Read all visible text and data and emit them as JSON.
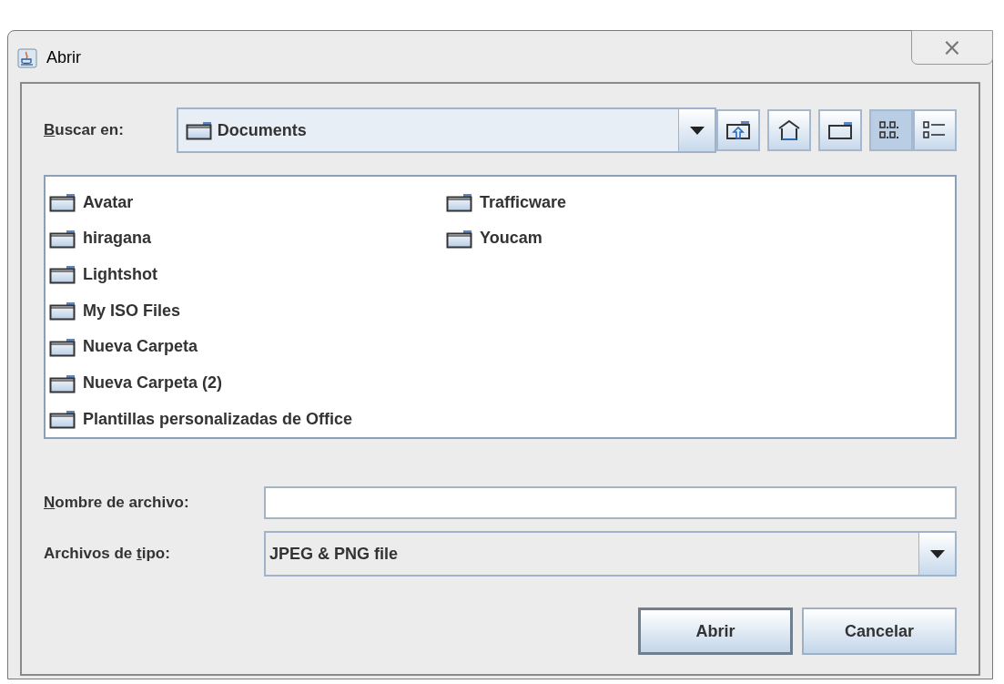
{
  "window": {
    "title": "Abrir",
    "close": "⨯"
  },
  "look_in": {
    "label": [
      {
        "text": "B",
        "mnemonic": true
      },
      {
        "text": "uscar en:",
        "mnemonic": false
      }
    ],
    "value": "Documents"
  },
  "toolbar": [
    {
      "kind": "up",
      "selected": false
    },
    {
      "kind": "home",
      "selected": false
    },
    {
      "kind": "new-folder",
      "selected": false
    },
    {
      "kind": "list",
      "selected": true
    },
    {
      "kind": "details",
      "selected": false
    }
  ],
  "files": [
    {
      "name": "Avatar"
    },
    {
      "name": "hiragana"
    },
    {
      "name": "Lightshot"
    },
    {
      "name": "My ISO Files"
    },
    {
      "name": "Nueva Carpeta"
    },
    {
      "name": "Nueva Carpeta (2)"
    },
    {
      "name": "Plantillas personalizadas de Office"
    },
    {
      "name": "Trafficware"
    },
    {
      "name": "Youcam"
    }
  ],
  "file_name": {
    "label": [
      {
        "text": "N",
        "mnemonic": true
      },
      {
        "text": "ombre de archivo:",
        "mnemonic": false
      }
    ]
  },
  "file_type": {
    "label": [
      {
        "text": "Archivos de ",
        "mnemonic": false
      },
      {
        "text": "t",
        "mnemonic": true
      },
      {
        "text": "ipo:",
        "mnemonic": false
      }
    ],
    "value": "JPEG & PNG file"
  },
  "buttons": [
    {
      "label": "Abrir",
      "default": true
    },
    {
      "label": "Cancelar",
      "default": false
    }
  ]
}
